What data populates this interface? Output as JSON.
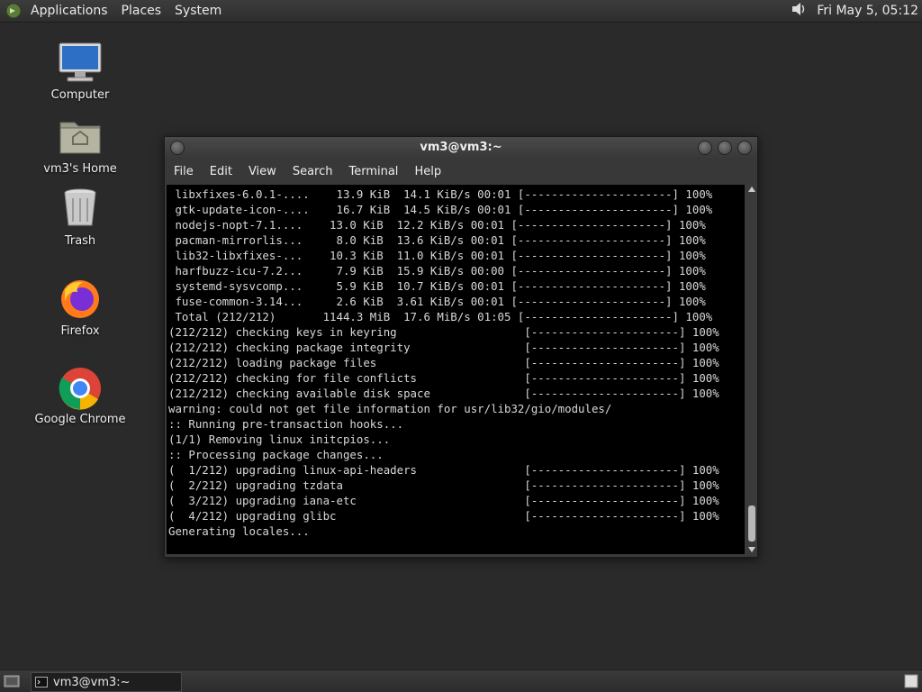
{
  "top_panel": {
    "menus": [
      "Applications",
      "Places",
      "System"
    ],
    "clock": "Fri May  5, 05:12",
    "volume_icon": "speaker-icon"
  },
  "desktop": {
    "icons": [
      {
        "label": "Computer",
        "icon": "computer-icon"
      },
      {
        "label": "vm3's Home",
        "icon": "home-folder-icon"
      },
      {
        "label": "Trash",
        "icon": "trash-icon"
      },
      {
        "label": "Firefox",
        "icon": "firefox-icon"
      },
      {
        "label": "Google Chrome",
        "icon": "chrome-icon"
      }
    ]
  },
  "terminal": {
    "title": "vm3@vm3:~",
    "menus": [
      "File",
      "Edit",
      "View",
      "Search",
      "Terminal",
      "Help"
    ],
    "lines": [
      " libxfixes-6.0.1-....    13.9 KiB  14.1 KiB/s 00:01 [----------------------] 100%",
      " gtk-update-icon-....    16.7 KiB  14.5 KiB/s 00:01 [----------------------] 100%",
      " nodejs-nopt-7.1....    13.0 KiB  12.2 KiB/s 00:01 [----------------------] 100%",
      " pacman-mirrorlis...     8.0 KiB  13.6 KiB/s 00:01 [----------------------] 100%",
      " lib32-libxfixes-...    10.3 KiB  11.0 KiB/s 00:01 [----------------------] 100%",
      " harfbuzz-icu-7.2...     7.9 KiB  15.9 KiB/s 00:00 [----------------------] 100%",
      " systemd-sysvcomp...     5.9 KiB  10.7 KiB/s 00:01 [----------------------] 100%",
      " fuse-common-3.14...     2.6 KiB  3.61 KiB/s 00:01 [----------------------] 100%",
      " Total (212/212)       1144.3 MiB  17.6 MiB/s 01:05 [----------------------] 100%",
      "(212/212) checking keys in keyring                   [----------------------] 100%",
      "(212/212) checking package integrity                 [----------------------] 100%",
      "(212/212) loading package files                      [----------------------] 100%",
      "(212/212) checking for file conflicts                [----------------------] 100%",
      "(212/212) checking available disk space              [----------------------] 100%",
      "warning: could not get file information for usr/lib32/gio/modules/",
      ":: Running pre-transaction hooks...",
      "(1/1) Removing linux initcpios...",
      ":: Processing package changes...",
      "(  1/212) upgrading linux-api-headers                [----------------------] 100%",
      "(  2/212) upgrading tzdata                           [----------------------] 100%",
      "(  3/212) upgrading iana-etc                         [----------------------] 100%",
      "(  4/212) upgrading glibc                            [----------------------] 100%",
      "Generating locales..."
    ]
  },
  "taskbar": {
    "task_label": "vm3@vm3:~"
  }
}
